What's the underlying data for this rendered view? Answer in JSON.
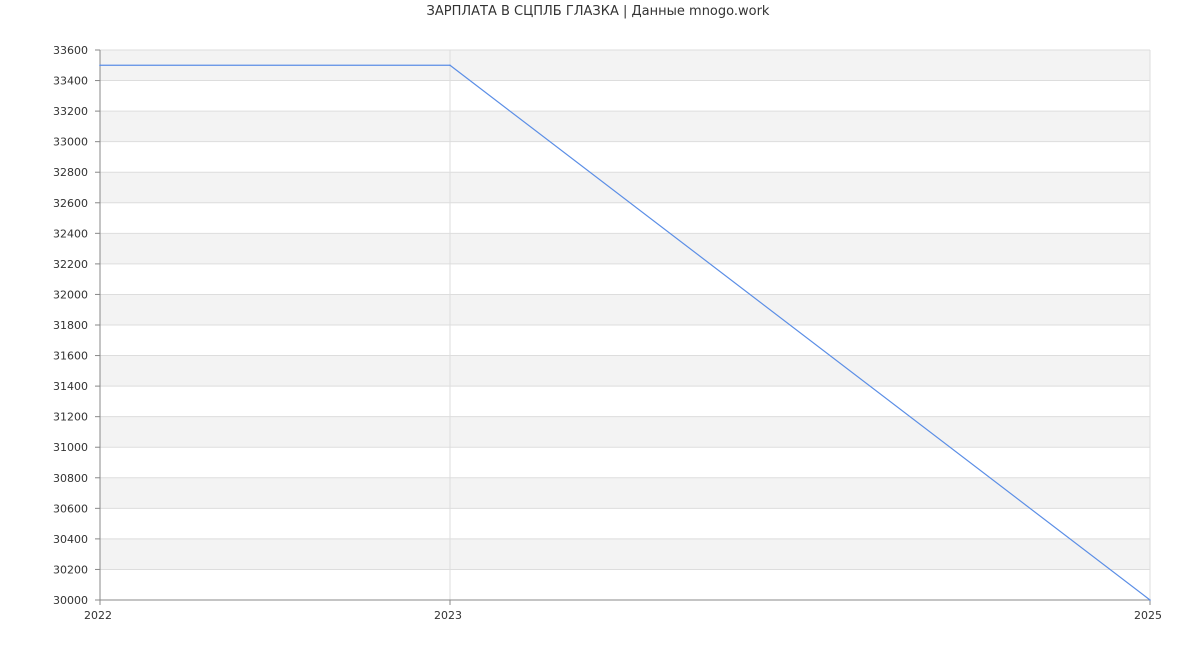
{
  "chart_data": {
    "type": "line",
    "title": "ЗАРПЛАТА В  СЦПЛБ ГЛАЗКА | Данные mnogo.work",
    "xlabel": "",
    "ylabel": "",
    "x": [
      "2022",
      "2023",
      "2025"
    ],
    "series": [
      {
        "values": [
          33500,
          33500,
          30000
        ],
        "color": "#5b8ee6"
      }
    ],
    "ylim": [
      30000,
      33600
    ],
    "y_ticks": [
      "30000",
      "30200",
      "30400",
      "30600",
      "30800",
      "31000",
      "31200",
      "31400",
      "31600",
      "31800",
      "32000",
      "32200",
      "32400",
      "32600",
      "32800",
      "33000",
      "33200",
      "33400",
      "33600"
    ],
    "x_ticks": [
      "2022",
      "2023",
      "2025"
    ],
    "grid": true,
    "band_color": "#f3f3f3",
    "grid_color": "#dddddd",
    "axis_color": "#888888"
  }
}
